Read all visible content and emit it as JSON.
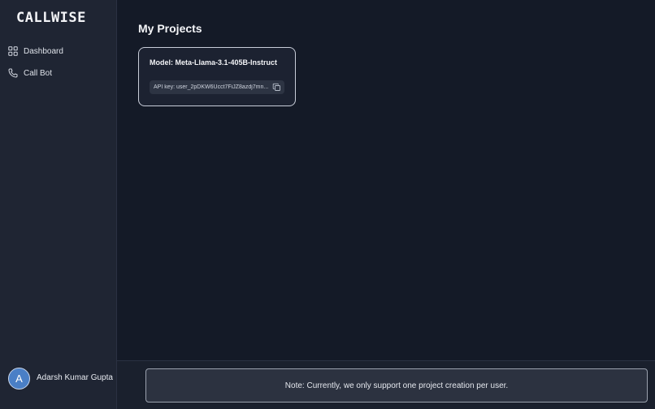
{
  "brand": "CALLWISE",
  "sidebar": {
    "items": [
      {
        "label": "Dashboard",
        "icon": "dashboard-grid-icon"
      },
      {
        "label": "Call Bot",
        "icon": "phone-icon"
      }
    ]
  },
  "user": {
    "initial": "A",
    "name": "Adarsh Kumar Gupta"
  },
  "main": {
    "title": "My Projects",
    "project": {
      "model": "Model: Meta-Llama-3.1-405B-Instruct",
      "api_key": "API key: user_2pDKW6Ucct7FiJZ8azdj7mn...",
      "copy_icon": "copy-icon"
    }
  },
  "footer": {
    "note": "Note: Currently, we only support one project creation per user."
  },
  "colors": {
    "background": "#141a27",
    "sidebar": "#1f2533",
    "avatar": "#4a7fc6",
    "card_border": "#c8cdd8"
  }
}
